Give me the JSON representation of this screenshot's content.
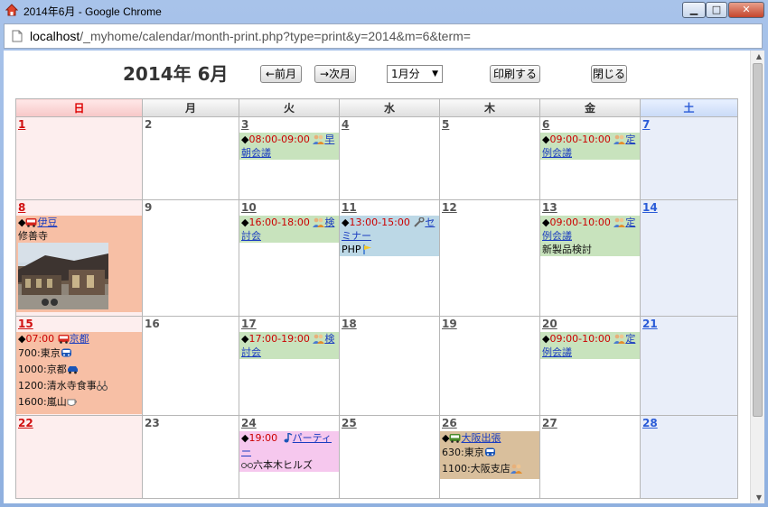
{
  "window": {
    "title": "2014年6月 - Google Chrome",
    "min_label": "▁",
    "max_label": "□",
    "close_label": "✕"
  },
  "address": {
    "host": "localhost",
    "path": "/_myhome/calendar/month-print.php?type=print&y=2014&m=6&term="
  },
  "toolbar": {
    "heading": "2014年 6月",
    "prev_label": "←前月",
    "next_label": "→次月",
    "range_value": "1月分",
    "print_label": "印刷する",
    "close_label": "閉じる"
  },
  "weekdays": [
    "日",
    "月",
    "火",
    "水",
    "木",
    "金",
    "土"
  ],
  "days": {
    "d1": "1",
    "d2": "2",
    "d3": "3",
    "d4": "4",
    "d5": "5",
    "d6": "6",
    "d7": "7",
    "d8": "8",
    "d9": "9",
    "d10": "10",
    "d11": "11",
    "d12": "12",
    "d13": "13",
    "d14": "14",
    "d15": "15",
    "d16": "16",
    "d17": "17",
    "d18": "18",
    "d19": "19",
    "d20": "20",
    "d21": "21",
    "d22": "22",
    "d23": "23",
    "d24": "24",
    "d25": "25",
    "d26": "26",
    "d27": "27",
    "d28": "28"
  },
  "events": {
    "e3": {
      "time": "08:00-09:00",
      "title": "早朝会議"
    },
    "e6": {
      "time": "09:00-10:00",
      "title": "定例会議"
    },
    "e8": {
      "title": "伊豆",
      "note": "修善寺"
    },
    "e10": {
      "time": "16:00-18:00",
      "title": "検討会"
    },
    "e11": {
      "time": "13:00-15:00",
      "title": "セミナー",
      "note": "PHP"
    },
    "e13": {
      "time": "09:00-10:00",
      "title": "定例会議",
      "note": "新製品検討"
    },
    "e15": {
      "time": "07:00",
      "title": "京都",
      "n1": "700:東京",
      "n2": "1000:京都",
      "n3": "1200:清水寺食事",
      "n4": "1600:嵐山"
    },
    "e17": {
      "time": "17:00-19:00",
      "title": "検討会"
    },
    "e20": {
      "time": "09:00-10:00",
      "title": "定例会議"
    },
    "e24": {
      "time": "19:00",
      "title": "パーティー",
      "note": "六本木ヒルズ"
    },
    "e26": {
      "title": "大阪出張",
      "n1": "630:東京",
      "n2": "1100:大阪支店"
    }
  },
  "colors": {
    "sunday": "#d01010",
    "saturday": "#2a5bd7",
    "time": "#cc0000",
    "link": "#1a3cc0"
  },
  "icons": [
    "house-icon",
    "page-icon",
    "people-icon",
    "bus-icon",
    "wrench-icon",
    "flag-icon",
    "train-icon",
    "car-icon",
    "utensils-icon",
    "coffee-icon",
    "music-note-icon",
    "glasses-icon"
  ]
}
